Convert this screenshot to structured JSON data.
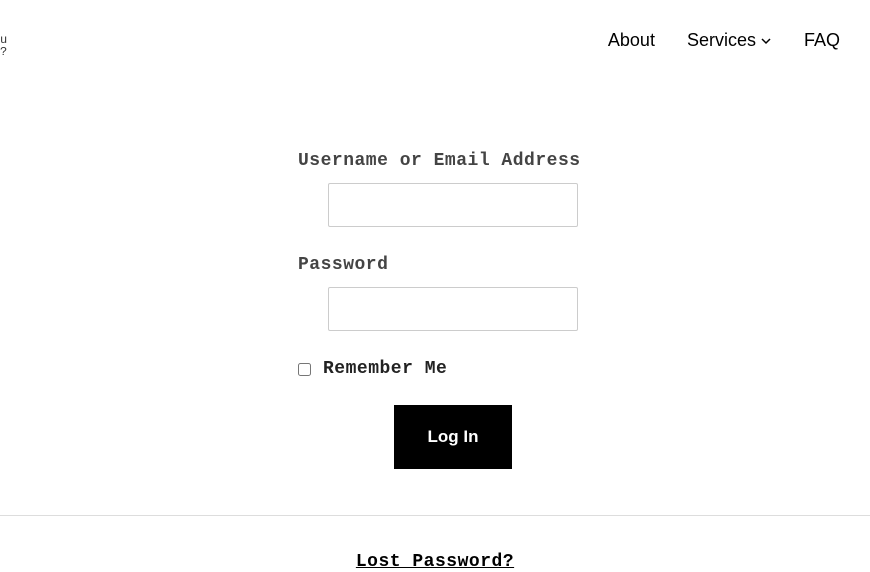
{
  "nav": {
    "about": "About",
    "services": "Services",
    "faq": "FAQ"
  },
  "form": {
    "username_label": "Username or Email Address",
    "password_label": "Password",
    "remember_label": "Remember Me",
    "login_button": "Log In"
  },
  "lost_password": "Lost Password?"
}
